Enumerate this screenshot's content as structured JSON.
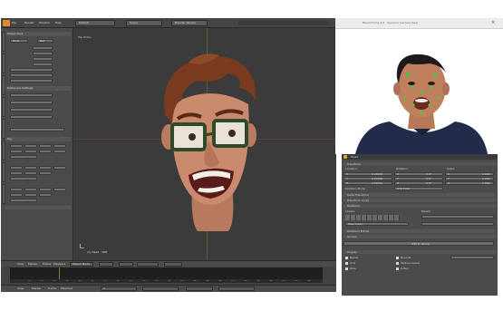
{
  "main_window": {
    "title": "",
    "menu": {
      "items": [
        "File",
        "Render",
        "Window",
        "Help"
      ],
      "layout": "Default",
      "scene": "Scene",
      "engine": "Blender Render"
    },
    "viewport": {
      "view_label": "Top Ortho",
      "object_label": "(1) Head · 3D8",
      "mode": "Object Mode"
    },
    "left_panel": {
      "sections": [
        "Shape Keys",
        "Reference Settings",
        "Rig"
      ],
      "buttons": [
        "Tools",
        "Ref",
        "Ref"
      ]
    },
    "timeline": {
      "menu": [
        "View",
        "Marker",
        "Frame",
        "Playback"
      ],
      "frame_label": "1",
      "ticks": [
        "0",
        "10",
        "20",
        "30",
        "40",
        "50",
        "60",
        "70",
        "80",
        "90",
        "100",
        "110",
        "120",
        "130",
        "140",
        "150",
        "160",
        "170",
        "180",
        "190",
        "200",
        "210",
        "220",
        "230",
        "240",
        "250"
      ]
    }
  },
  "camera_window": {
    "title": "Blend Hump 2.8 · Dynamic Camera View"
  },
  "properties_panel": {
    "header": "Head",
    "sections": [
      "Transform",
      "Delta Transform",
      "Transform Locks",
      "Relations",
      "Relations Extras",
      "Groups",
      "Display"
    ],
    "transform": {
      "columns": [
        "Location:",
        "Rotation:",
        "Scale:"
      ],
      "rows": [
        {
          "axis": "X",
          "location": "0.00000",
          "rotation": "0.0°",
          "scale": "1.000"
        },
        {
          "axis": "Y",
          "location": "0.00000",
          "rotation": "0.0°",
          "scale": "1.000"
        },
        {
          "axis": "Z",
          "location": "0.00000",
          "rotation": "0.0°",
          "scale": "1.000"
        }
      ],
      "rotation_mode_label": "Rotation Mode:",
      "rotation_mode_value": "XYZ Euler"
    },
    "relations": {
      "layers_label": "Layers:",
      "parent_label": "Parent:",
      "pass_index": "Pass Index"
    },
    "add_button": "Add to Group",
    "display": [
      "Name",
      "Axis",
      "Wire",
      "Bounds",
      "Texture Space",
      "X-Ray"
    ]
  },
  "colors": {
    "blender_bg": "#3d3d3d",
    "panel_bg": "#4a4a4a",
    "viewport_bg": "#3b3b3b",
    "skin": "#c98a6d",
    "hair": "#7a3a20",
    "glasses": "#2f4a2a",
    "active_tab": "#6a8fc0"
  }
}
